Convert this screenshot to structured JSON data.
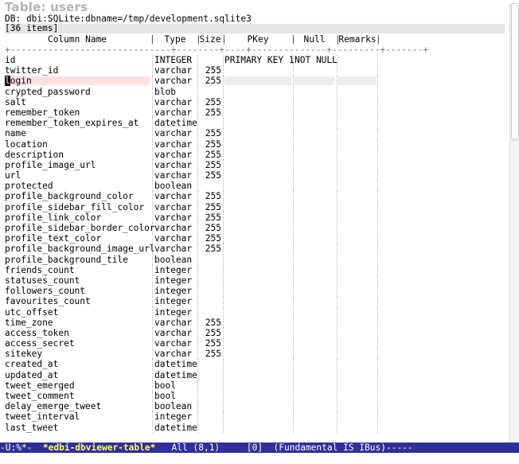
{
  "title": "Table: users",
  "db_line": "DB: dbi:SQLite:dbname=/tmp/development.sqlite3",
  "item_count": "[36 items]",
  "headers": {
    "column_name": "Column Name",
    "type": "Type",
    "size": "Size",
    "pkey": "PKey",
    "null": "Null",
    "remarks": "Remarks"
  },
  "rows": [
    {
      "name": "id",
      "type": "INTEGER",
      "size": "",
      "pkey": "PRIMARY KEY 1",
      "null": "NOT NULL",
      "remarks": ""
    },
    {
      "name": "twitter_id",
      "type": "varchar",
      "size": "255",
      "pkey": "",
      "null": "",
      "remarks": ""
    },
    {
      "name": "login",
      "type": "varchar",
      "size": "255",
      "pkey": "",
      "null": "",
      "remarks": ""
    },
    {
      "name": "crypted_password",
      "type": "blob",
      "size": "",
      "pkey": "",
      "null": "",
      "remarks": ""
    },
    {
      "name": "salt",
      "type": "varchar",
      "size": "255",
      "pkey": "",
      "null": "",
      "remarks": ""
    },
    {
      "name": "remember_token",
      "type": "varchar",
      "size": "255",
      "pkey": "",
      "null": "",
      "remarks": ""
    },
    {
      "name": "remember_token_expires_at",
      "type": "datetime",
      "size": "",
      "pkey": "",
      "null": "",
      "remarks": ""
    },
    {
      "name": "name",
      "type": "varchar",
      "size": "255",
      "pkey": "",
      "null": "",
      "remarks": ""
    },
    {
      "name": "location",
      "type": "varchar",
      "size": "255",
      "pkey": "",
      "null": "",
      "remarks": ""
    },
    {
      "name": "description",
      "type": "varchar",
      "size": "255",
      "pkey": "",
      "null": "",
      "remarks": ""
    },
    {
      "name": "profile_image_url",
      "type": "varchar",
      "size": "255",
      "pkey": "",
      "null": "",
      "remarks": ""
    },
    {
      "name": "url",
      "type": "varchar",
      "size": "255",
      "pkey": "",
      "null": "",
      "remarks": ""
    },
    {
      "name": "protected",
      "type": "boolean",
      "size": "",
      "pkey": "",
      "null": "",
      "remarks": ""
    },
    {
      "name": "profile_background_color",
      "type": "varchar",
      "size": "255",
      "pkey": "",
      "null": "",
      "remarks": ""
    },
    {
      "name": "profile_sidebar_fill_color",
      "type": "varchar",
      "size": "255",
      "pkey": "",
      "null": "",
      "remarks": ""
    },
    {
      "name": "profile_link_color",
      "type": "varchar",
      "size": "255",
      "pkey": "",
      "null": "",
      "remarks": ""
    },
    {
      "name": "profile_sidebar_border_color",
      "type": "varchar",
      "size": "255",
      "pkey": "",
      "null": "",
      "remarks": ""
    },
    {
      "name": "profile_text_color",
      "type": "varchar",
      "size": "255",
      "pkey": "",
      "null": "",
      "remarks": ""
    },
    {
      "name": "profile_background_image_url",
      "type": "varchar",
      "size": "255",
      "pkey": "",
      "null": "",
      "remarks": ""
    },
    {
      "name": "profile_background_tile",
      "type": "boolean",
      "size": "",
      "pkey": "",
      "null": "",
      "remarks": ""
    },
    {
      "name": "friends_count",
      "type": "integer",
      "size": "",
      "pkey": "",
      "null": "",
      "remarks": ""
    },
    {
      "name": "statuses_count",
      "type": "integer",
      "size": "",
      "pkey": "",
      "null": "",
      "remarks": ""
    },
    {
      "name": "followers_count",
      "type": "integer",
      "size": "",
      "pkey": "",
      "null": "",
      "remarks": ""
    },
    {
      "name": "favourites_count",
      "type": "integer",
      "size": "",
      "pkey": "",
      "null": "",
      "remarks": ""
    },
    {
      "name": "utc_offset",
      "type": "integer",
      "size": "",
      "pkey": "",
      "null": "",
      "remarks": ""
    },
    {
      "name": "time_zone",
      "type": "varchar",
      "size": "255",
      "pkey": "",
      "null": "",
      "remarks": ""
    },
    {
      "name": "access_token",
      "type": "varchar",
      "size": "255",
      "pkey": "",
      "null": "",
      "remarks": ""
    },
    {
      "name": "access_secret",
      "type": "varchar",
      "size": "255",
      "pkey": "",
      "null": "",
      "remarks": ""
    },
    {
      "name": "sitekey",
      "type": "varchar",
      "size": "255",
      "pkey": "",
      "null": "",
      "remarks": ""
    },
    {
      "name": "created_at",
      "type": "datetime",
      "size": "",
      "pkey": "",
      "null": "",
      "remarks": ""
    },
    {
      "name": "updated_at",
      "type": "datetime",
      "size": "",
      "pkey": "",
      "null": "",
      "remarks": ""
    },
    {
      "name": "tweet_emerged",
      "type": "bool",
      "size": "",
      "pkey": "",
      "null": "",
      "remarks": ""
    },
    {
      "name": "tweet_comment",
      "type": "bool",
      "size": "",
      "pkey": "",
      "null": "",
      "remarks": ""
    },
    {
      "name": "delay_emerge_tweet",
      "type": "boolean",
      "size": "",
      "pkey": "",
      "null": "",
      "remarks": ""
    },
    {
      "name": "tweet_interval",
      "type": "integer",
      "size": "",
      "pkey": "",
      "null": "",
      "remarks": ""
    },
    {
      "name": "last_tweet",
      "type": "datetime",
      "size": "",
      "pkey": "",
      "null": "",
      "remarks": ""
    }
  ],
  "selected_row": 2,
  "modeline": {
    "status": "-U:%*-  ",
    "buffer": "*edbi-dbviewer-table*",
    "position": "   All (8,1)     [0]  (Fundamental IS IBus)-----"
  },
  "colors": {
    "modeline_bg": "#2f2f9a",
    "highlight": "#ffe0e0",
    "title": "#b3b3b3"
  }
}
